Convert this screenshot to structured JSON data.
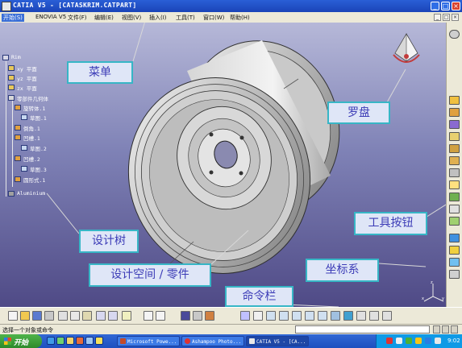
{
  "window": {
    "title": "CATIA V5 - [CATASKRIM.CATPART]",
    "min_label": "_",
    "max_label": "□",
    "close_label": "×"
  },
  "menu": [
    "开始(S)",
    "ENOVIA V5",
    "文件(F)",
    "编辑(E)",
    "视图(V)",
    "插入(I)",
    "工具(T)",
    "窗口(W)",
    "帮助(H)"
  ],
  "doc_controls": {
    "min": "_",
    "max": "□",
    "close": "×"
  },
  "tree": {
    "root": "Rim",
    "items": [
      {
        "label": "xy 平面",
        "icon_color": "#e8c85a"
      },
      {
        "label": "yz 平面",
        "icon_color": "#e8c85a"
      },
      {
        "label": "zx 平面",
        "icon_color": "#e8c85a"
      },
      {
        "label": "零部件几何体",
        "icon_color": "#d8d8d8"
      },
      {
        "label": "旋转体.1",
        "icon_color": "#e0a040"
      },
      {
        "label": "草图.1",
        "icon_color": "#c8d8f0"
      },
      {
        "label": "倒角.1",
        "icon_color": "#e0a040"
      },
      {
        "label": "凹槽.1",
        "icon_color": "#e0a040"
      },
      {
        "label": "草图.2",
        "icon_color": "#c8d8f0"
      },
      {
        "label": "凹槽.2",
        "icon_color": "#e0a040"
      },
      {
        "label": "草图.3",
        "icon_color": "#c8d8f0"
      },
      {
        "label": "圆形式.1",
        "icon_color": "#e0a040"
      },
      {
        "label": "Aluminium",
        "icon_color": "#a0a0a0"
      }
    ]
  },
  "annotations": {
    "menu": "菜单",
    "compass": "罗盘",
    "toolbuttons": "工具按钮",
    "tree": "设计树",
    "workspace": "设计空间 / 零件",
    "axes": "坐标系",
    "commandbar": "命令栏"
  },
  "axis_labels": {
    "x": "x",
    "y": "y",
    "z": "z"
  },
  "status": {
    "text": "选择一个对象或命令"
  },
  "taskbar": {
    "start": "开始",
    "tasks": [
      {
        "label": "Microsoft Powe...",
        "color": "#c24a2a"
      },
      {
        "label": "Ashampoo Photo...",
        "color": "#d33"
      },
      {
        "label": "CATIA V5 - [CA...",
        "color": "#e8e8e8"
      }
    ],
    "clock": "9:02"
  },
  "colors": {
    "title_bar": "#2a5fd6",
    "workspace_top": "#b6b8d8",
    "workspace_bottom": "#4f4a86",
    "callout_border": "#37b6c6",
    "callout_text": "#3c3cb7"
  }
}
